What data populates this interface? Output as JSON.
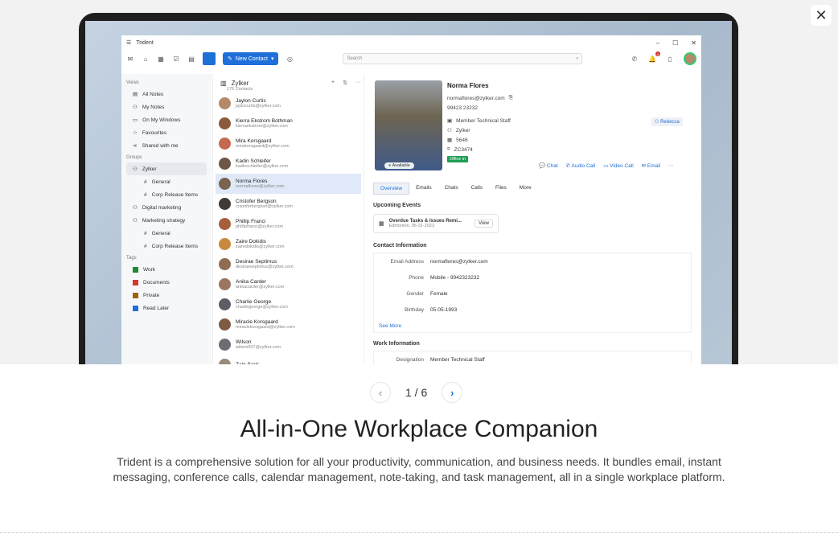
{
  "app": {
    "window_title": "Trident",
    "new_contact_label": "New Contact",
    "search_placeholder": "Search",
    "notifications_count": "4"
  },
  "sidebar": {
    "views_heading": "Views",
    "views": [
      "All Notes",
      "My Notes",
      "On My Windows",
      "Favourites",
      "Shared with me"
    ],
    "groups_heading": "Groups",
    "groups": [
      {
        "label": "Zylker",
        "children": [
          "General",
          "Corp Release Items"
        ]
      },
      {
        "label": "Digital marketing",
        "children": []
      },
      {
        "label": "Marketing strategy",
        "children": [
          "General",
          "Corp Release Items"
        ]
      }
    ],
    "tags_heading": "Tags",
    "tags": [
      {
        "label": "Work",
        "color": "#1f8a2e"
      },
      {
        "label": "Documents",
        "color": "#d33a2c"
      },
      {
        "label": "Private",
        "color": "#a0620f"
      },
      {
        "label": "Read Later",
        "color": "#1e6fd9"
      }
    ]
  },
  "contact_list": {
    "title": "Zylker",
    "count": "176 Contacts",
    "contacts": [
      {
        "name": "Jaylon Curtis",
        "email": "jaylocurtis@zylker.com",
        "color": "#b58a6a"
      },
      {
        "name": "Kierra Ekstrom Bothman",
        "email": "kierraekstrom@zylker.com",
        "color": "#8a5a3c"
      },
      {
        "name": "Mira Korsgaard",
        "email": "mirakorsgaard@zylker.com",
        "color": "#c46a4e"
      },
      {
        "name": "Kadin Schleifer",
        "email": "kadinschleifer@zylker.com",
        "color": "#6d5646"
      },
      {
        "name": "Norma Flores",
        "email": "normaflores@zylker.com",
        "color": "#7a6450"
      },
      {
        "name": "Cristofer Bergson",
        "email": "cristoferbergson@zylker.com",
        "color": "#3e3a36"
      },
      {
        "name": "Phillip Franci",
        "email": "phillipfranci@zylker.com",
        "color": "#a5603a"
      },
      {
        "name": "Zaire Dokidis",
        "email": "zairedokidis@zylker.com",
        "color": "#c9893f"
      },
      {
        "name": "Desirae Septimus",
        "email": "desiraeseptimus@zylker.com",
        "color": "#8e6b52"
      },
      {
        "name": "Anika Carder",
        "email": "anikacarder@zylker.com",
        "color": "#9a7560"
      },
      {
        "name": "Charlie George",
        "email": "charliegeorge@zylker.com",
        "color": "#5b5e66"
      },
      {
        "name": "Miracle Korsgaard",
        "email": "miraclekorsgaard@zylker.com",
        "color": "#7f5b44"
      },
      {
        "name": "Wilson",
        "email": "wilson007@zylker.com",
        "color": "#6b6f74"
      },
      {
        "name": "Zain Saris",
        "email": "",
        "color": "#9a8a7a"
      }
    ]
  },
  "detail": {
    "name": "Norma Flores",
    "email": "normaflores@zylker.com",
    "phone": "99423 23232",
    "role": "Member Technical Staff",
    "company": "Zylker",
    "ext": "5646",
    "code": "ZC3474",
    "office_status": "Office in",
    "availability": "Available",
    "tag": "Rebecca",
    "actions": [
      "Chat",
      "Audio Call",
      "Video Call",
      "Email"
    ],
    "tabs": [
      "Overview",
      "Emails",
      "Chats",
      "Calls",
      "Files",
      "More"
    ],
    "upcoming_heading": "Upcoming Events",
    "event_title": "Overdue Tasks & Issues Remi...",
    "event_sub": "Edmonton, 05-31-2023",
    "event_view": "View",
    "contact_info_heading": "Contact Information",
    "contact_rows": [
      {
        "k": "Email Address",
        "v": "normaflores@zylker.com",
        "link": true
      },
      {
        "k": "Phone",
        "v": "Mobile - 9942323232",
        "link": false
      },
      {
        "k": "Gender",
        "v": "Female",
        "link": false
      },
      {
        "k": "Birthday",
        "v": "05-05-1993",
        "link": false
      }
    ],
    "see_more": "See More",
    "work_info_heading": "Work Information",
    "work_rows": [
      {
        "k": "Designation",
        "v": "Member Technical Staff"
      }
    ]
  },
  "carousel": {
    "page": "1 / 6",
    "headline": "All-in-One Workplace Companion",
    "description": "Trident is a comprehensive solution for all your productivity, communication, and business needs. It bundles email, instant messaging, conference calls, calendar management, note-taking, and task management, all in a single workplace platform."
  }
}
